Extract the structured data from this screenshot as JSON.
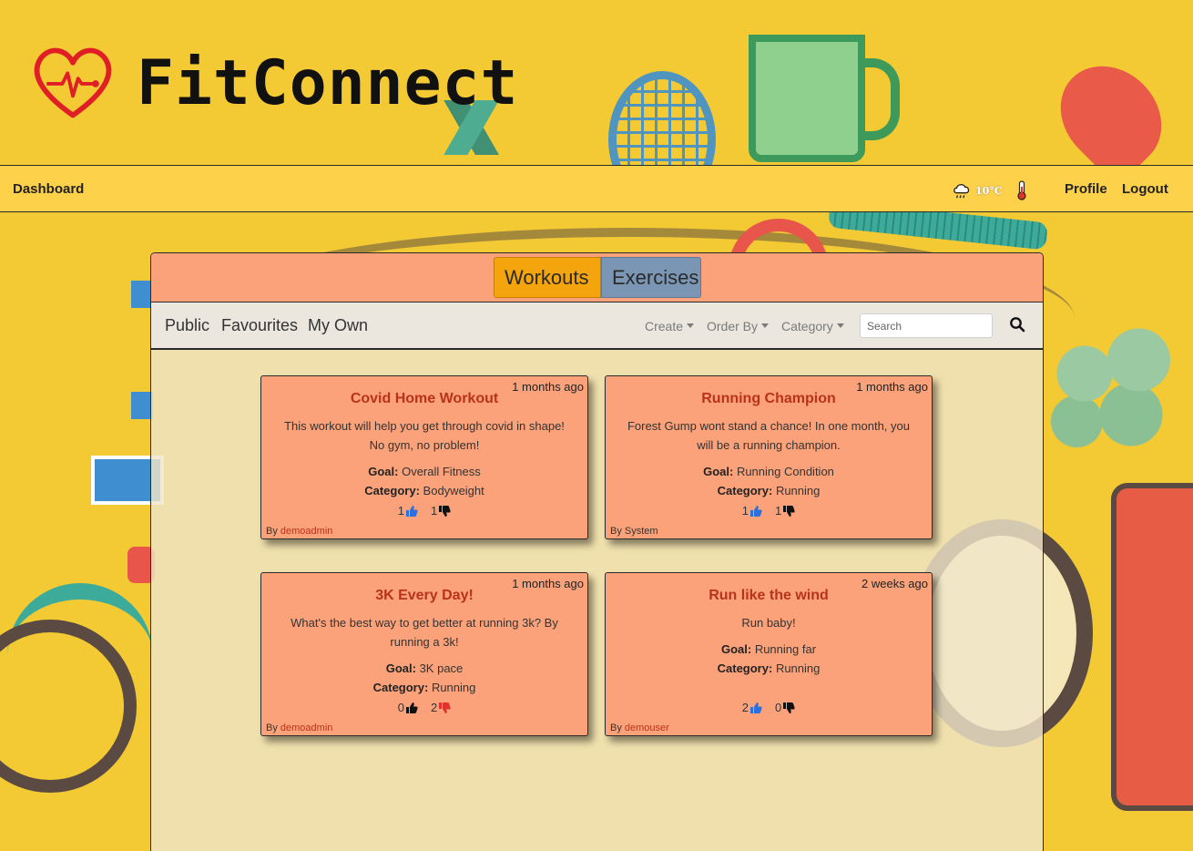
{
  "app": {
    "name": "FitConnect"
  },
  "nav": {
    "dashboard": "Dashboard",
    "weather_temp": "10°C",
    "profile": "Profile",
    "logout": "Logout"
  },
  "tabs": [
    {
      "label": "Workouts",
      "active": true
    },
    {
      "label": "Exercises",
      "active": false
    }
  ],
  "filters": {
    "links": [
      "Public",
      "Favourites",
      "My Own"
    ],
    "dropdowns": [
      "Create",
      "Order By",
      "Category"
    ],
    "search_placeholder": "Search"
  },
  "cards": [
    {
      "time": "1 months ago",
      "title": "Covid Home Workout",
      "description": "This workout will help you get through covid in shape! No gym, no problem!",
      "goal_label": "Goal:",
      "goal": "Overall Fitness",
      "category_label": "Category:",
      "category": "Bodyweight",
      "likes": "1",
      "dislikes": "1",
      "by_label": "By",
      "author": "demoadmin"
    },
    {
      "time": "1 months ago",
      "title": "Running Champion",
      "description": "Forest Gump wont stand a chance! In one month, you will be a running champion.",
      "goal_label": "Goal:",
      "goal": "Running Condition",
      "category_label": "Category:",
      "category": "Running",
      "likes": "1",
      "dislikes": "1",
      "by_label": "By",
      "author": "System"
    },
    {
      "time": "1 months ago",
      "title": "3K Every Day!",
      "description": "What's the best way to get better at running 3k? By running a 3k!",
      "goal_label": "Goal:",
      "goal": "3K pace",
      "category_label": "Category:",
      "category": "Running",
      "likes": "0",
      "dislikes": "2",
      "by_label": "By",
      "author": "demoadmin"
    },
    {
      "time": "2 weeks ago",
      "title": "Run like the wind",
      "description": "Run baby!",
      "goal_label": "Goal:",
      "goal": "Running far",
      "category_label": "Category:",
      "category": "Running",
      "likes": "2",
      "dislikes": "0",
      "by_label": "By",
      "author": "demouser"
    }
  ],
  "colors": {
    "background": "#f3c934",
    "navbar": "#fed14a",
    "tab_active": "#f4a40c",
    "tab_inactive": "#7b96b4",
    "card": "#fba27a",
    "card_title": "#b8331a",
    "like_blue": "#2e6fe0",
    "dislike_red": "#e0332e"
  }
}
